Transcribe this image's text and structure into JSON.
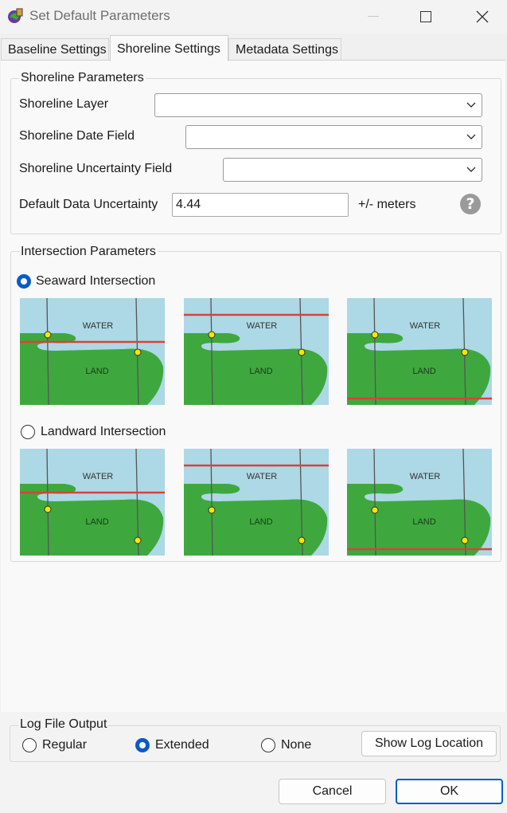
{
  "window": {
    "title": "Set Default Parameters"
  },
  "tabs": [
    {
      "label": "Baseline Settings"
    },
    {
      "label": "Shoreline Settings"
    },
    {
      "label": "Metadata Settings"
    }
  ],
  "shoreline_params": {
    "group_label": "Shoreline Parameters",
    "layer_label": "Shoreline Layer",
    "layer_value": "",
    "date_field_label": "Shoreline Date Field",
    "date_field_value": "",
    "uncertainty_field_label": "Shoreline Uncertainty Field",
    "uncertainty_field_value": "",
    "default_uncertainty_label": "Default Data Uncertainty",
    "default_uncertainty_value": "4.44",
    "units": "+/- meters",
    "help_glyph": "?"
  },
  "intersection_params": {
    "group_label": "Intersection Parameters",
    "seaward_label": "Seaward Intersection",
    "landward_label": "Landward Intersection",
    "selected": "seaward",
    "diagram_water_label": "WATER",
    "diagram_land_label": "LAND"
  },
  "log_output": {
    "group_label": "Log File Output",
    "options": [
      "Regular",
      "Extended",
      "None"
    ],
    "selected": "Extended",
    "show_log_button": "Show Log Location"
  },
  "footer": {
    "cancel_label": "Cancel",
    "ok_label": "OK"
  },
  "colors": {
    "accent": "#0a5bc4",
    "water": "#add8e6",
    "land": "#3ea83e",
    "shoreline": "#d9423a",
    "point": "#f5e600"
  }
}
